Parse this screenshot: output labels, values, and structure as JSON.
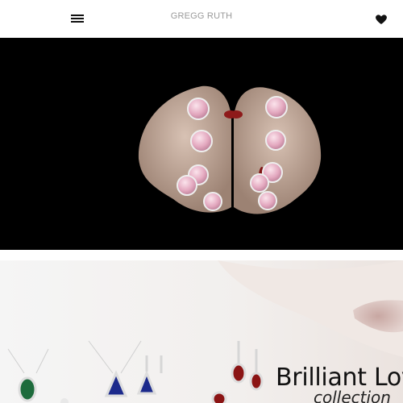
{
  "header": {
    "brand": "GREGG RUTH",
    "menu_icon": "hamburger-menu-icon",
    "favorites_icon": "heart-icon"
  },
  "hero": {
    "image": "photo of two fists wearing pink diamond halo rings"
  },
  "banner": {
    "title": "Brilliant Lov",
    "subtitle": "collection",
    "image": "emerald, sapphire and ruby jewelry with woman's lips"
  },
  "colors": {
    "hero_bg": "#000000",
    "brand_text": "#9a9a9a",
    "icon": "#111111"
  }
}
